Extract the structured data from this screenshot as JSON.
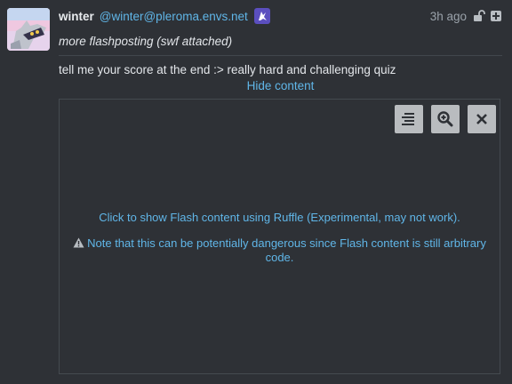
{
  "post": {
    "display_name": "winter",
    "handle": "@winter@pleroma.envs.net",
    "time_ago": "3h ago",
    "subject": "more flashposting (swf attached)",
    "body": "tell me your score at the end :> really hard and challenging quiz",
    "hide_content_label": "Hide content"
  },
  "flash": {
    "click_message": "Click to show Flash content using Ruffle (Experimental, may not work).",
    "warning": "Note that this can be potentially dangerous since Flash content is still arbitrary code."
  },
  "icons": {
    "avatar": "avatar-image",
    "bot": "bot-badge-icon",
    "visibility": "unlocked-icon",
    "expand": "expand-plus-icon",
    "menu": "menu-lines-icon",
    "zoom": "zoom-in-icon",
    "close": "close-icon",
    "warning": "warning-triangle-icon"
  },
  "colors": {
    "background": "#2e3136",
    "link": "#60b6e8",
    "text": "#e3e6ea",
    "muted": "#9aa2aa",
    "button": "#b9bcbf"
  }
}
